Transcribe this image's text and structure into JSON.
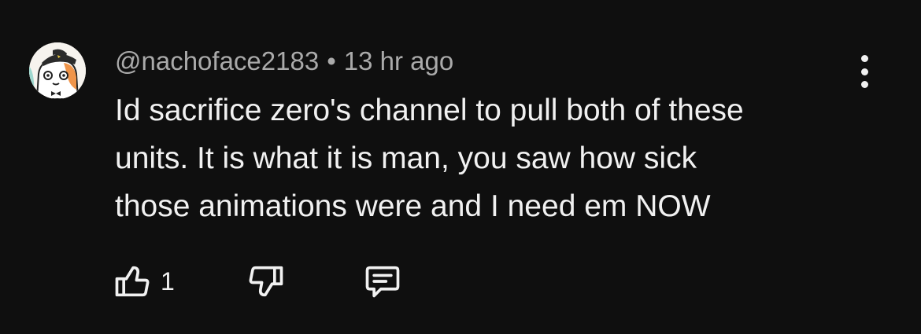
{
  "comment": {
    "author": "@nachoface2183",
    "separator": "•",
    "timestamp": "13 hr ago",
    "lines": [
      "Id sacrifice zero's channel to pull both of these",
      "units. It is what it is man, you saw how sick",
      "those animations were and I need em NOW"
    ],
    "like_count": "1"
  },
  "icons": {
    "avatar": "cartoon-cat-avatar",
    "more": "vertical-ellipsis-icon",
    "like": "thumbs-up-icon",
    "dislike": "thumbs-down-icon",
    "reply": "comment-bubble-icon"
  },
  "colors": {
    "background": "#0f0f0f",
    "text": "#f1f1f1",
    "meta_text": "#aaaaaa"
  }
}
